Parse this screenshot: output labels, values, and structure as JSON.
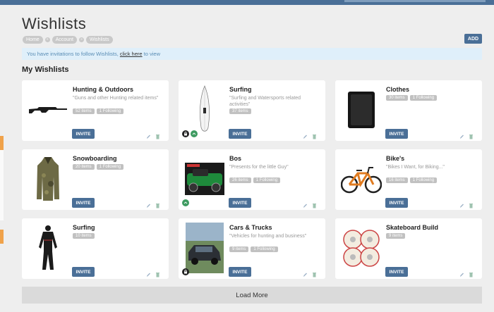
{
  "page": {
    "title": "Wishlists"
  },
  "breadcrumb": [
    "Home",
    "Account",
    "Wishlists"
  ],
  "breadcrumb_separator": "»",
  "header": {
    "add_label": "ADD"
  },
  "banner": {
    "text": "You have invitations to follow Wishlists,",
    "link": "click here",
    "suffix": "to view"
  },
  "section": {
    "title": "My Wishlists"
  },
  "colors": {
    "primary": "#4a6f97",
    "banner_bg": "#dfeffa",
    "share_green": "#3e9b61",
    "accent_orange": "#f0a24a"
  },
  "wishlists": [
    {
      "name": "Hunting & Outdoors",
      "description": "\"Guns and other Hunting related items\"",
      "items": "52 items",
      "following": "1 Following",
      "image": "rifle",
      "private": false,
      "shared": false
    },
    {
      "name": "Surfing",
      "description": "\"Surfing and Watersports related activities\"",
      "items": "37 items",
      "following": "",
      "image": "surfboard",
      "private": true,
      "shared": true
    },
    {
      "name": "Clothes",
      "description": "",
      "items": "30 items",
      "following": "1 Following",
      "image": "wallet",
      "private": false,
      "shared": false
    },
    {
      "name": "Snowboarding",
      "description": "",
      "items": "20 items",
      "following": "1 Following",
      "image": "jacket",
      "private": false,
      "shared": false
    },
    {
      "name": "Bos",
      "description": "\"Presents for the little Guy\"",
      "items": "26 items",
      "following": "1 Following",
      "image": "lego-car",
      "private": false,
      "shared": true
    },
    {
      "name": "Bike's",
      "description": "\"Bikes I Want, for Biking...\"",
      "items": "16 items",
      "following": "1 Following",
      "image": "bike",
      "private": false,
      "shared": false
    },
    {
      "name": "Surfing",
      "description": "",
      "items": "10 items",
      "following": "",
      "image": "wetsuit",
      "private": false,
      "shared": false
    },
    {
      "name": "Cars & Trucks",
      "description": "\"Vehicles for hunting and business\"",
      "items": "9 items",
      "following": "1 Following",
      "image": "suv",
      "private": true,
      "shared": false
    },
    {
      "name": "Skateboard Build",
      "description": "",
      "items": "9 items",
      "following": "",
      "image": "wheels",
      "private": false,
      "shared": false
    }
  ],
  "card": {
    "invite_label": "INVITE"
  },
  "footer": {
    "load_more_label": "Load More"
  }
}
